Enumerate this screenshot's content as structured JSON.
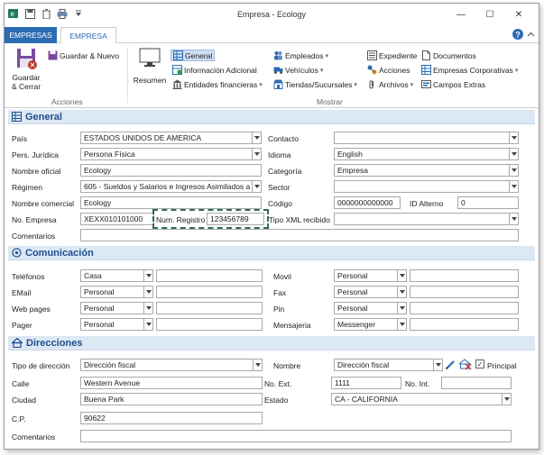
{
  "window": {
    "title": "Empresa - Ecology"
  },
  "window_controls": {
    "minimize": "—",
    "maximize": "☐",
    "close": "✕"
  },
  "tabs": {
    "file": "EMPRESAS",
    "main": "EMPRESA"
  },
  "ribbon": {
    "save_close_line1": "Guardar",
    "save_close_line2": "& Cerrar",
    "save_new": "Guardar & Nuevo",
    "acciones_group": "Acciones",
    "resumen": "Resumen",
    "general": "General",
    "info_adicional": "Información Adicional",
    "entidades": "Entidades financieras",
    "empleados": "Empleados",
    "vehiculos": "Vehículos",
    "tiendas": "Tiendas/Sucursales",
    "expediente": "Expediente",
    "acciones": "Acciones",
    "archivos": "Archivos",
    "documentos": "Documentos",
    "empresas_corp": "Empresas Corporativas",
    "campos_extras": "Campos Extras",
    "mostrar_group": "Mostrar"
  },
  "general": {
    "heading": "General",
    "pais_label": "País",
    "pais": "ESTADOS UNIDOS DE AMERICA",
    "pers_label": "Pers. Jurídica",
    "pers": "Persona Física",
    "nombre_label": "Nombre oficial",
    "nombre": "Ecology",
    "regimen_label": "Régimen",
    "regimen": "605 - Sueldos y Salarios e Ingresos Asimilados a",
    "comercial_label": "Nombre comercial",
    "comercial": "Ecology",
    "noempresa_label": "No. Empresa",
    "noempresa": "XEXX010101000",
    "numreg_label": "Num. Registro",
    "numreg": "123456789",
    "comentarios_label": "Comentarios",
    "comentarios": "",
    "contacto_label": "Contacto",
    "contacto": "",
    "idioma_label": "Idioma",
    "idioma": "English",
    "categoria_label": "Categoría",
    "categoria": "Empresa",
    "sector_label": "Sector",
    "sector": "",
    "codigo_label": "Código",
    "codigo": "0000000000000",
    "idalterno_label": "ID Alterno",
    "idalterno": "0",
    "tipoxml_label": "Tipo XML recibido",
    "tipoxml": ""
  },
  "comunicacion": {
    "heading": "Comunicación",
    "telefonos_label": "Teléfonos",
    "telefonos_type": "Casa",
    "email_label": "EMail",
    "email_type": "Personal",
    "web_label": "Web pages",
    "web_type": "Personal",
    "pager_label": "Pager",
    "pager_type": "Personal",
    "movil_label": "Movil",
    "movil_type": "Personal",
    "fax_label": "Fax",
    "fax_type": "Personal",
    "pin_label": "Pin",
    "pin_type": "Personal",
    "mensajeria_label": "Mensajeria",
    "mensajeria_type": "Messenger"
  },
  "direcciones": {
    "heading": "Direcciones",
    "tipo_label": "Tipo de dirección",
    "tipo": "Dirección fiscal",
    "nombre_label": "Nombre",
    "nombre": "Dirección fiscal",
    "principal_label": "Principal",
    "calle_label": "Calle",
    "calle": "Western Avenue",
    "noext_label": "No. Ext.",
    "noext": "1111",
    "noint_label": "No. Int.",
    "noint": "",
    "ciudad_label": "Ciudad",
    "ciudad": "Buena Park",
    "estado_label": "Estado",
    "estado": "CA - CALIFORNIA",
    "cp_label": "C.P.",
    "cp": "90622",
    "comentarios_label": "Comentarios",
    "comentarios": ""
  },
  "colors": {
    "accent": "#2b6cb3",
    "section_bg": "#dde8f5",
    "heading": "#1f4e8c"
  }
}
